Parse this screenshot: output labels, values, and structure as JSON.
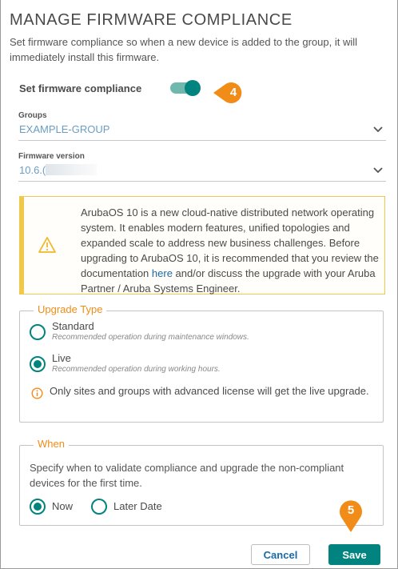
{
  "page": {
    "title": "MANAGE FIRMWARE COMPLIANCE",
    "subtitle": "Set firmware compliance so when a new device is added to the group, it will immediately install this firmware."
  },
  "toggle": {
    "label": "Set firmware compliance",
    "on": true
  },
  "callouts": {
    "step4": "4",
    "step5": "5"
  },
  "groups": {
    "label": "Groups",
    "value": "EXAMPLE-GROUP"
  },
  "firmware": {
    "label": "Firmware version",
    "value": "10.6.("
  },
  "alert": {
    "text_before_link": "ArubaOS 10 is a new cloud-native distributed network operating system. It enables modern features, unified topologies and expanded scale to address new business challenges. Before upgrading to ArubaOS 10, it is recommended that you review the documentation ",
    "link": "here",
    "text_after_link": " and/or discuss the upgrade with your Aruba Partner / Aruba Systems Engineer."
  },
  "upgrade_type": {
    "legend": "Upgrade Type",
    "options": [
      {
        "label": "Standard",
        "desc": "Recommended operation during maintenance windows.",
        "selected": false
      },
      {
        "label": "Live",
        "desc": "Recommended operation during working hours.",
        "selected": true
      }
    ],
    "info": "Only sites and groups with advanced license will get the live upgrade."
  },
  "when": {
    "legend": "When",
    "text": "Specify when to validate compliance and upgrade the non-compliant devices for the first time.",
    "options": [
      {
        "label": "Now",
        "selected": true
      },
      {
        "label": "Later Date",
        "selected": false
      }
    ]
  },
  "buttons": {
    "cancel": "Cancel",
    "save": "Save"
  },
  "colors": {
    "accent": "#01847f",
    "warning": "#f0c94a",
    "callout": "#f28c18",
    "link": "#1a6aa6"
  }
}
